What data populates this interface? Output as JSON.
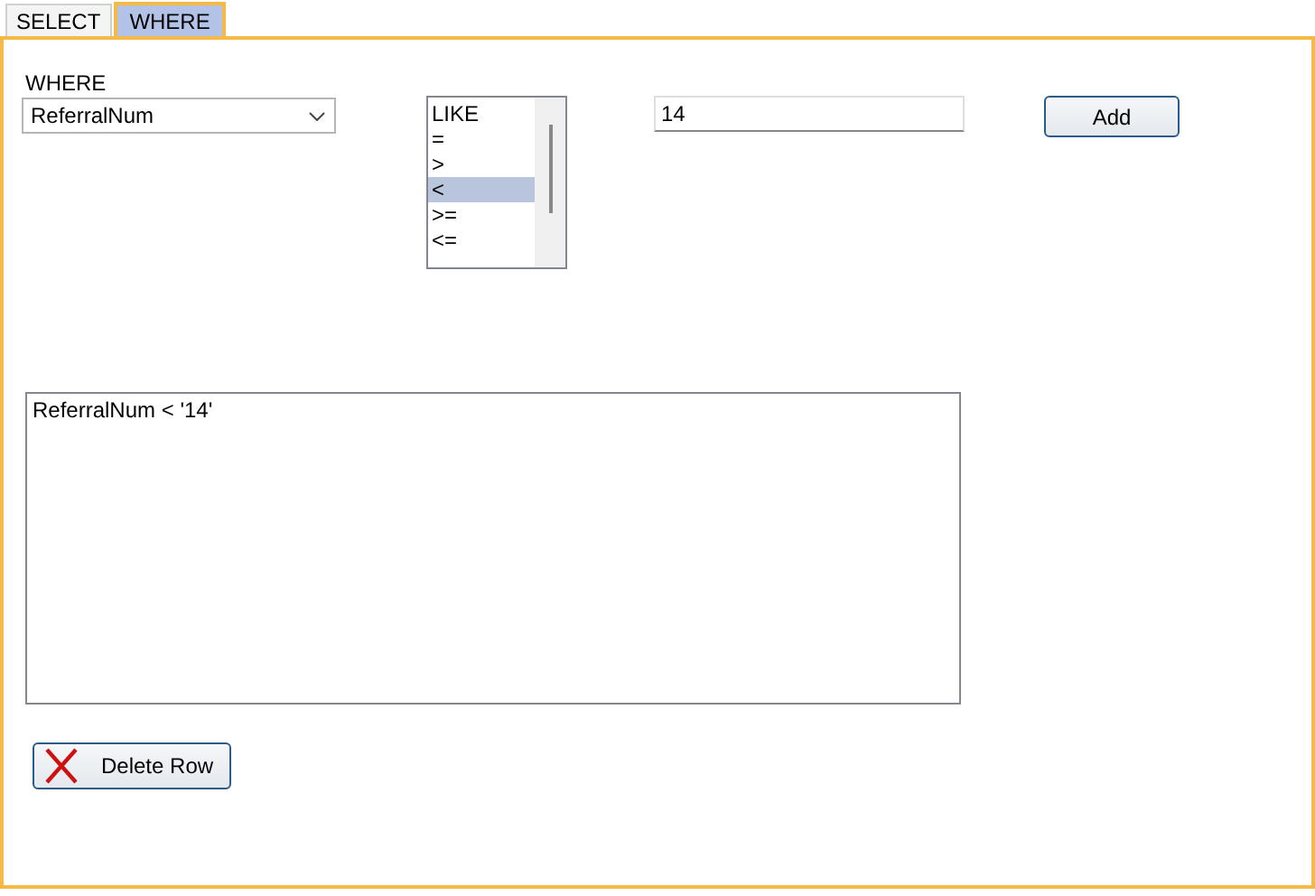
{
  "tabs": [
    {
      "label": "SELECT",
      "selected": false
    },
    {
      "label": "WHERE",
      "selected": true
    }
  ],
  "where_label": "WHERE",
  "field_combo": {
    "value": "ReferralNum"
  },
  "operators": [
    {
      "label": "LIKE",
      "selected": false
    },
    {
      "label": "=",
      "selected": false
    },
    {
      "label": ">",
      "selected": false
    },
    {
      "label": "<",
      "selected": true
    },
    {
      "label": ">=",
      "selected": false
    },
    {
      "label": "<=",
      "selected": false
    }
  ],
  "value_field": {
    "value": "14"
  },
  "add_button": "Add",
  "clauses": [
    "ReferralNum < '14'"
  ],
  "delete_button": "Delete Row"
}
